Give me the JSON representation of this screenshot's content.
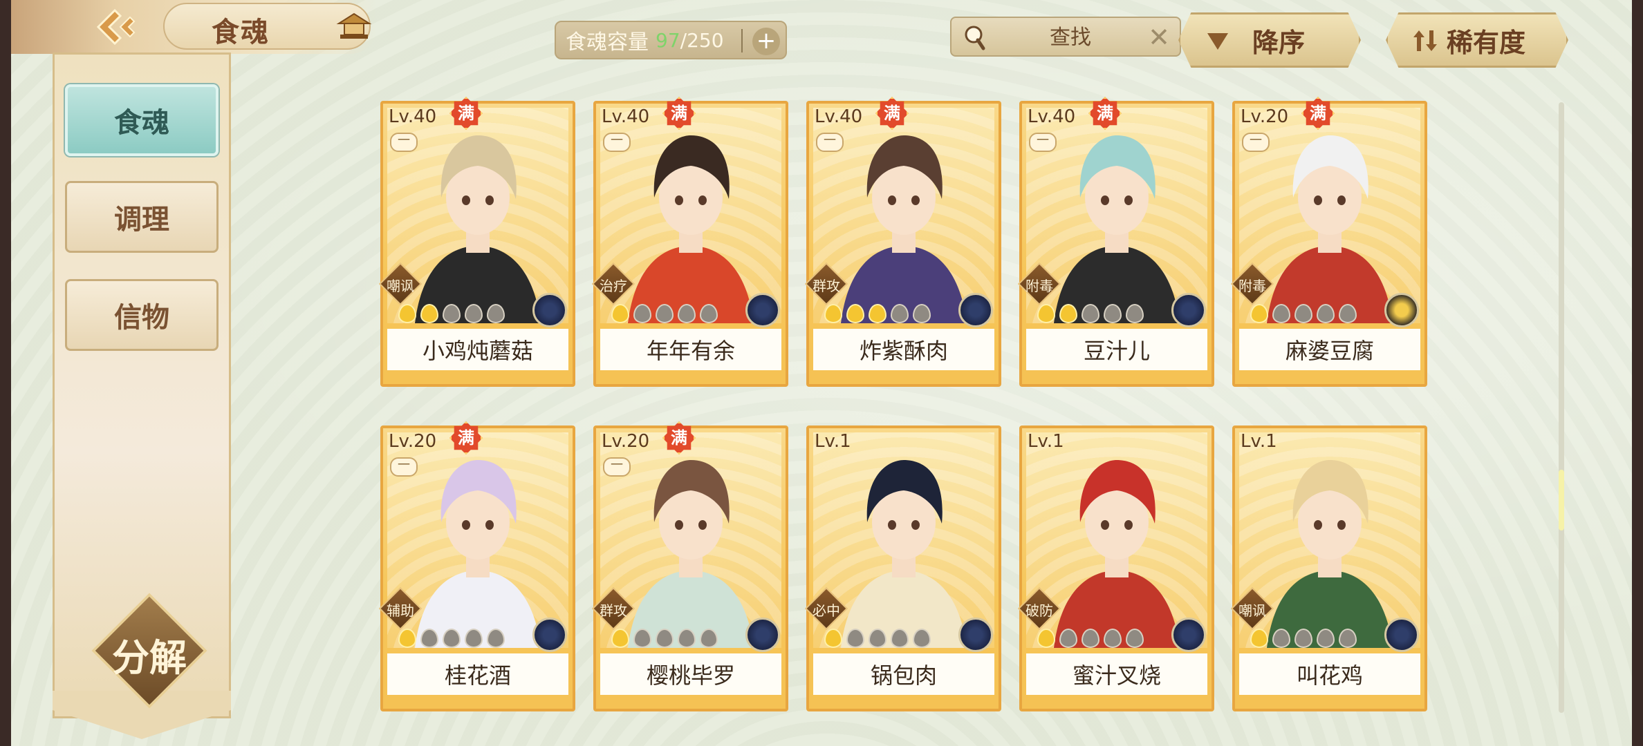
{
  "header": {
    "title": "食魂",
    "capacity": {
      "label": "食魂容量",
      "current": "97",
      "separator": "/",
      "max": "250",
      "add": "+"
    },
    "search": {
      "placeholder": "查找",
      "clear": "✕"
    },
    "sort_order_label": "降序",
    "rarity_label": "稀有度"
  },
  "sidebar": {
    "tabs": [
      {
        "label": "食魂",
        "active": true
      },
      {
        "label": "调理",
        "active": false
      },
      {
        "label": "信物",
        "active": false
      }
    ],
    "decompose_label": "分解"
  },
  "colors": {
    "capacity_current": "#7fd36a",
    "card_frame": "#e8a640",
    "active_tab": "#8ccbc3"
  },
  "cards": [
    {
      "level": "Lv.40",
      "full": "满",
      "minus": "一",
      "role": "嘲讽",
      "stars": 2,
      "element": "blue-flower-icon",
      "name": "小鸡炖蘑菇"
    },
    {
      "level": "Lv.40",
      "full": "满",
      "minus": "一",
      "role": "治疗",
      "stars": 1,
      "element": "blue-flower-icon",
      "name": "年年有余"
    },
    {
      "level": "Lv.40",
      "full": "满",
      "minus": "一",
      "role": "群攻",
      "stars": 3,
      "element": "blue-flower-icon",
      "name": "炸紫酥肉"
    },
    {
      "level": "Lv.40",
      "full": "满",
      "minus": "一",
      "role": "附毒",
      "stars": 2,
      "element": "blue-flower-icon",
      "name": "豆汁儿"
    },
    {
      "level": "Lv.20",
      "full": "满",
      "minus": "一",
      "role": "附毒",
      "stars": 1,
      "element": "gold-flower-icon",
      "name": "麻婆豆腐"
    },
    {
      "level": "Lv.20",
      "full": "满",
      "minus": "一",
      "role": "辅助",
      "stars": 1,
      "element": "blue-flower-icon",
      "name": "桂花酒"
    },
    {
      "level": "Lv.20",
      "full": "满",
      "minus": "一",
      "role": "群攻",
      "stars": 1,
      "element": "blue-flower-icon",
      "name": "樱桃毕罗"
    },
    {
      "level": "Lv.1",
      "full": "",
      "minus": "",
      "role": "必中",
      "stars": 1,
      "element": "blue-flower-icon",
      "name": "锅包肉"
    },
    {
      "level": "Lv.1",
      "full": "",
      "minus": "",
      "role": "破防",
      "stars": 1,
      "element": "blue-flower-icon",
      "name": "蜜汁叉烧"
    },
    {
      "level": "Lv.1",
      "full": "",
      "minus": "",
      "role": "嘲讽",
      "stars": 1,
      "element": "blue-flower-icon",
      "name": "叫花鸡"
    }
  ]
}
